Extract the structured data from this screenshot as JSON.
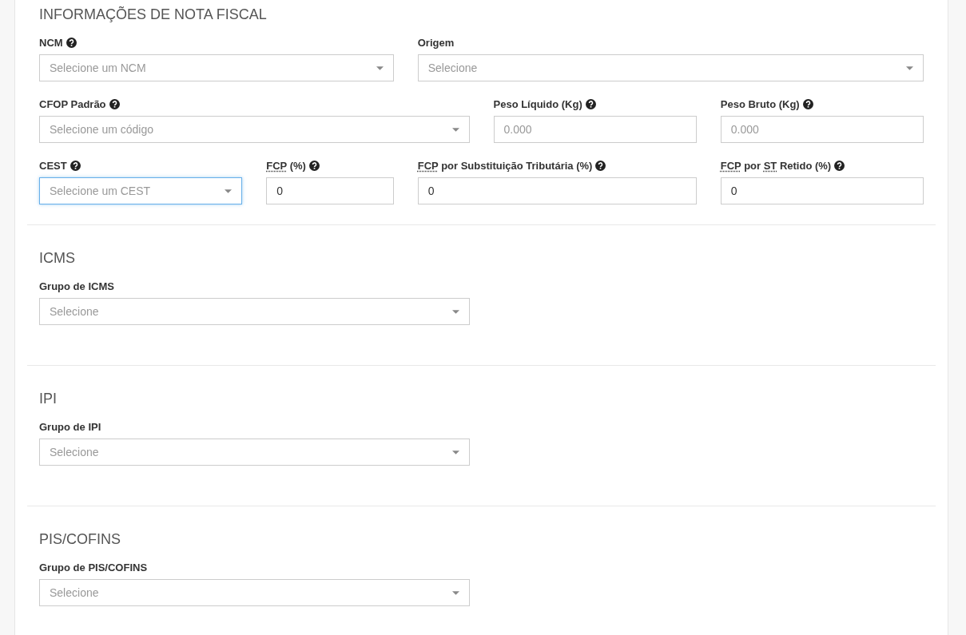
{
  "sections": [
    {
      "title": "INFORMAÇÕES DE NOTA FISCAL",
      "fields": [
        {
          "label": [
            {
              "text": "NCM",
              "abbr": false
            }
          ],
          "help": true,
          "kind": "select",
          "placeholder": "Selecione um NCM",
          "focused": false
        },
        {
          "label": [
            {
              "text": "Origem",
              "abbr": false
            }
          ],
          "help": false,
          "kind": "select",
          "placeholder": "Selecione",
          "focused": false
        },
        {
          "label": [
            {
              "text": "CFOP Padrão",
              "abbr": false
            }
          ],
          "help": true,
          "kind": "select",
          "placeholder": "Selecione um código",
          "focused": false
        },
        {
          "label": [
            {
              "text": "Peso Líquido (Kg)",
              "abbr": false
            }
          ],
          "help": true,
          "kind": "input",
          "placeholder": "0.000",
          "focused": false
        },
        {
          "label": [
            {
              "text": "Peso Bruto (Kg)",
              "abbr": false
            }
          ],
          "help": true,
          "kind": "input",
          "placeholder": "0.000",
          "focused": false
        },
        {
          "label": [
            {
              "text": "CEST",
              "abbr": false
            }
          ],
          "help": true,
          "kind": "select",
          "placeholder": "Selecione um CEST",
          "focused": true
        },
        {
          "label": [
            {
              "text": "FCP",
              "abbr": true
            },
            {
              "text": " (%)",
              "abbr": false
            }
          ],
          "help": true,
          "kind": "input",
          "value": "0",
          "focused": false
        },
        {
          "label": [
            {
              "text": "FCP",
              "abbr": true
            },
            {
              "text": " por Substituição Tributária (%)",
              "abbr": false
            }
          ],
          "help": true,
          "kind": "input",
          "value": "0",
          "focused": false
        },
        {
          "label": [
            {
              "text": "FCP",
              "abbr": true
            },
            {
              "text": " por ",
              "abbr": false
            },
            {
              "text": "ST",
              "abbr": true
            },
            {
              "text": " Retido (%)",
              "abbr": false
            }
          ],
          "help": true,
          "kind": "input",
          "value": "0",
          "focused": false
        }
      ]
    },
    {
      "title": "ICMS",
      "fields": [
        {
          "label": [
            {
              "text": "Grupo de ICMS",
              "abbr": false
            }
          ],
          "help": false,
          "kind": "select",
          "placeholder": "Selecione",
          "focused": false
        }
      ]
    },
    {
      "title": "IPI",
      "fields": [
        {
          "label": [
            {
              "text": "Grupo de IPI",
              "abbr": false
            }
          ],
          "help": false,
          "kind": "select",
          "placeholder": "Selecione",
          "focused": false
        }
      ]
    },
    {
      "title": "PIS/COFINS",
      "fields": [
        {
          "label": [
            {
              "text": "Grupo de PIS/COFINS",
              "abbr": false
            }
          ],
          "help": false,
          "kind": "select",
          "placeholder": "Selecione",
          "focused": false
        }
      ]
    }
  ]
}
